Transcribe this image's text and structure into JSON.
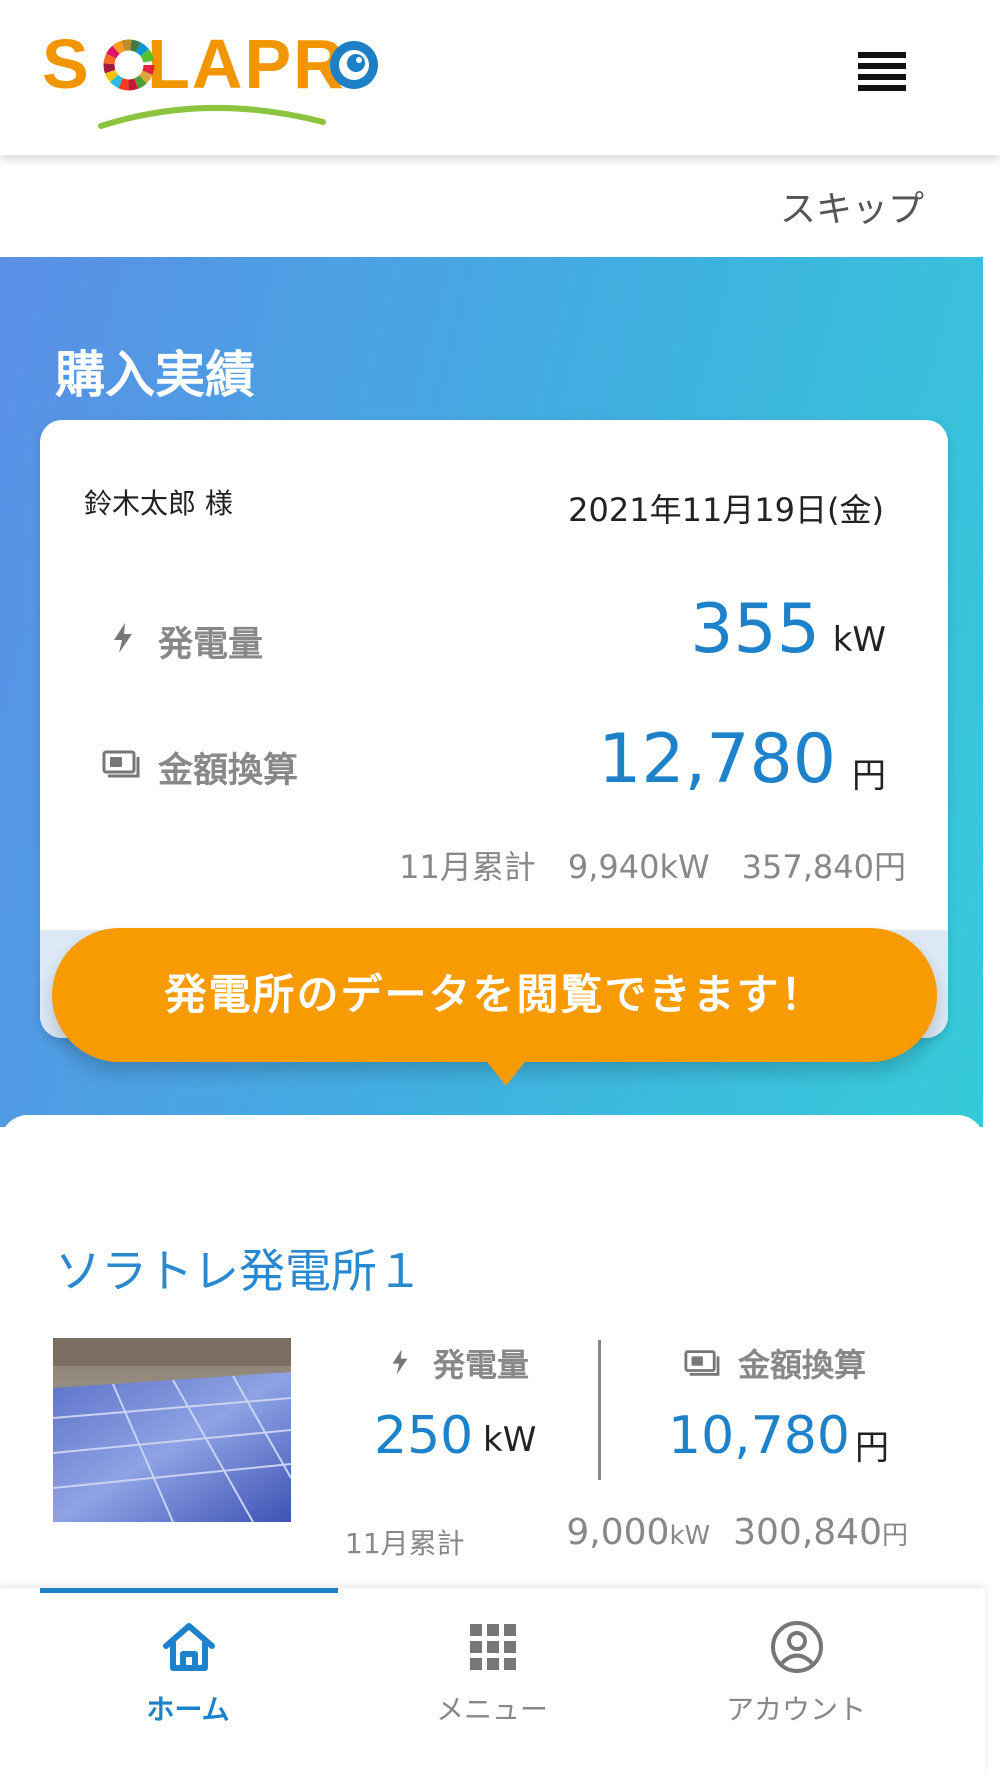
{
  "header": {
    "logo_text": "SOLAPRO",
    "logo_parts": [
      "S",
      "O",
      "LAPR",
      "O"
    ],
    "menu_icon": "hamburger-menu-icon"
  },
  "skip_label": "スキップ",
  "purchase": {
    "title": "購入実績",
    "user_name": "鈴木太郎 様",
    "date": "2021年11月19日(金)",
    "generation_label": "発電量",
    "generation_value": "355",
    "generation_unit": "kW",
    "amount_label": "金額換算",
    "amount_value": "12,780",
    "amount_unit": "円",
    "monthly_summary": "11月累計　9,940kW　357,840円"
  },
  "bubble_text": "発電所のデータを閲覧できます！",
  "plant": {
    "name": "ソラトレ発電所１",
    "generation_label": "発電量",
    "generation_value": "250",
    "generation_unit": "kW",
    "amount_label": "金額換算",
    "amount_value": "10,780",
    "amount_unit": "円",
    "month_label": "11月累計",
    "month_kw_value": "9,000",
    "month_kw_unit": "kW",
    "month_yen_value": "300,840",
    "month_yen_unit": "円"
  },
  "tabs": [
    {
      "label": "ホーム",
      "icon": "home-icon",
      "active": true
    },
    {
      "label": "メニュー",
      "icon": "grid-menu-icon",
      "active": false
    },
    {
      "label": "アカウント",
      "icon": "account-icon",
      "active": false
    }
  ],
  "colors": {
    "accent_blue": "#1d82c9",
    "bubble_orange": "#f89b00",
    "logo_orange": "#f29600"
  }
}
